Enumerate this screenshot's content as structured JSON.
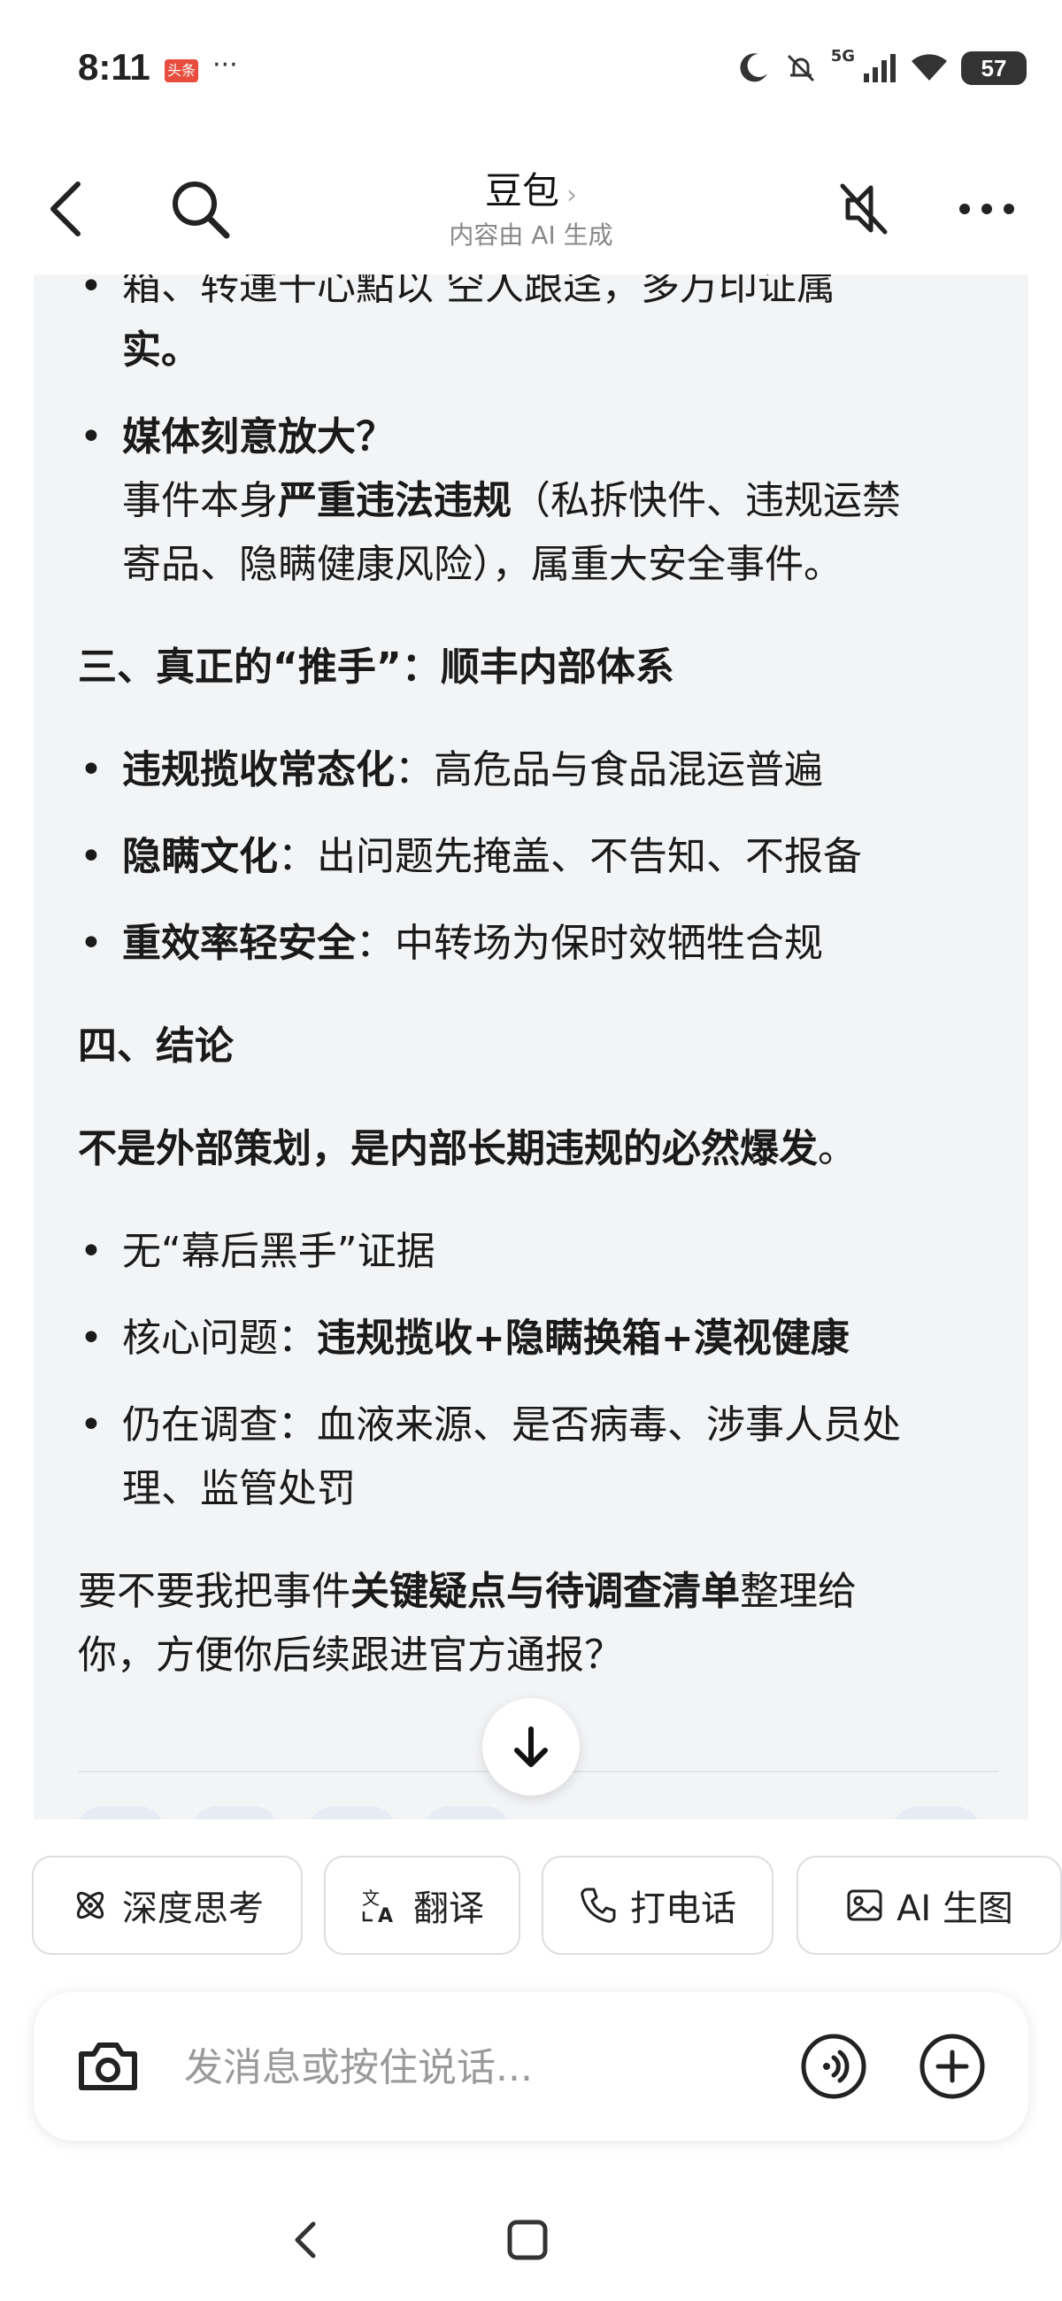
{
  "status_bar": {
    "time": "8:11",
    "app_badge": "头条",
    "more_dots": "···",
    "network": "5G",
    "battery": "57"
  },
  "header": {
    "title": "豆包",
    "title_chevron": "›",
    "subtitle": "内容由 AI 生成",
    "icons": [
      "back-icon",
      "search-icon",
      "speaker-muted-icon",
      "more-icon"
    ]
  },
  "message": {
    "cut_line_1": "箱、转運千心點以 空人跟迳，多万印证属",
    "cut_line_2": "实。",
    "bullet_media": {
      "title": "媒体刻意放大？",
      "line1_prefix": "事件本身",
      "line1_bold": "严重违法违规",
      "line1_suffix": "（私拆快件、违规运禁",
      "line2": "寄品、隐瞒健康风险），属重大安全事件。"
    },
    "section3": {
      "heading": "三、真正的“推手”：顺丰内部体系",
      "items": [
        {
          "bold": "违规揽收常态化",
          "text": "：高危品与食品混运普遍"
        },
        {
          "bold": "隐瞒文化",
          "text": "：出问题先掩盖、不告知、不报备"
        },
        {
          "bold": "重效率轻安全",
          "text": "：中转场为保时效牺牲合规"
        }
      ]
    },
    "section4": {
      "heading": "四、结论",
      "conclusion_bold": "不是外部策划，是内部长期违规的必然爆发",
      "conclusion_end": "。",
      "items": [
        {
          "text": "无“幕后黑手”证据"
        },
        {
          "prefix": "核心问题：",
          "bold": "违规揽收+隐瞒换箱+漠视健康"
        },
        {
          "line1": "仍在调查：血液来源、是否病毒、涉事人员处",
          "line2": "理、监管处罚"
        }
      ]
    },
    "closing": {
      "prefix": "要不要我把事件",
      "bold": "关键疑点与待调查清单",
      "suffix": "整理给",
      "line2": "你，方便你后续跟进官方通报？"
    }
  },
  "quick_actions": [
    {
      "label": "深度思考",
      "icon": "atom-icon"
    },
    {
      "label": "翻译",
      "icon": "translate-icon"
    },
    {
      "label": "打电话",
      "icon": "phone-icon"
    },
    {
      "label": "AI 生图",
      "icon": "image-icon"
    }
  ],
  "input_bar": {
    "placeholder": "发消息或按住说话...",
    "icons": [
      "camera-icon",
      "voice-icon",
      "plus-icon"
    ]
  },
  "nav_bar": {
    "icons": [
      "nav-back-icon",
      "nav-home-icon"
    ]
  },
  "colors": {
    "background": "#ffffff",
    "card_background": "#f3f4f6",
    "text_primary": "#1a1a1a",
    "text_secondary": "#888888"
  }
}
